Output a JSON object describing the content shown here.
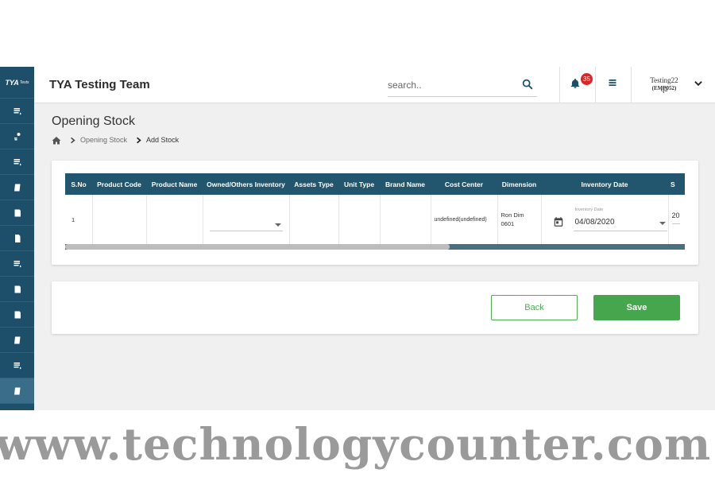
{
  "sidebar": {
    "logo": "TYA",
    "logo_sub": "Tests",
    "items": [
      {
        "icon": "stack-icon"
      },
      {
        "icon": "person-pin-icon"
      },
      {
        "icon": "stack-icon"
      },
      {
        "icon": "receipt-icon"
      },
      {
        "icon": "ledger-icon"
      },
      {
        "icon": "document-icon"
      },
      {
        "icon": "stack-icon"
      },
      {
        "icon": "ledger-icon"
      },
      {
        "icon": "ledger-icon"
      },
      {
        "icon": "receipt-icon"
      },
      {
        "icon": "stack-icon"
      },
      {
        "icon": "receipt-icon",
        "active": true
      }
    ]
  },
  "header": {
    "title": "TYA Testing Team",
    "search_placeholder": "search..",
    "notification_count": "35",
    "user_name": "Testing22 qa",
    "user_id": "(EMP052)"
  },
  "page": {
    "title": "Opening Stock",
    "breadcrumb": [
      "Opening Stock",
      "Add Stock"
    ]
  },
  "table": {
    "columns": [
      "S.No",
      "Product Code",
      "Product Name",
      "Owned/Others Inventory",
      "Assets Type",
      "Unit Type",
      "Brand Name",
      "Cost Center",
      "Dimension",
      "Inventory Date",
      "S"
    ],
    "row": {
      "sno": "1",
      "product_code": "",
      "product_name": "",
      "owned_inventory": "",
      "assets_type": "",
      "unit_type": "",
      "brand_name": "",
      "cost_center": "undefined(undefined)",
      "dimension": "Ron Dim 0601",
      "inventory_date_label": "Inventory Date",
      "inventory_date": "04/08/2020",
      "next_col_partial": "20"
    },
    "scroll_fraction": 0.62
  },
  "actions": {
    "back_label": "Back",
    "save_label": "Save"
  },
  "colors": {
    "sidebar": "#1d4f6a",
    "table_header": "#22566f",
    "primary_green": "#46a64e",
    "badge_red": "#e02424"
  },
  "watermark": "www.technologycounter.com"
}
